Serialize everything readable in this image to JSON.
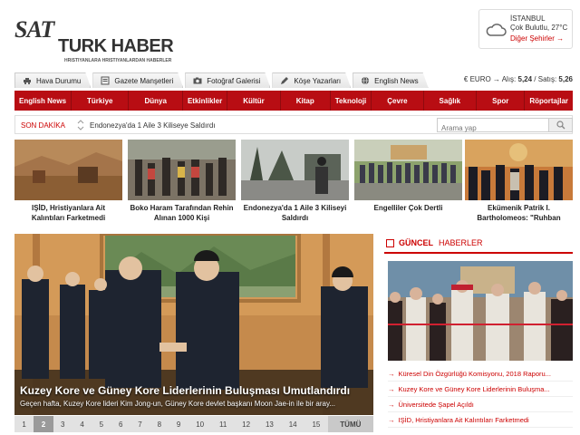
{
  "logo": {
    "badge": "SAT",
    "name": "TURK HABER",
    "tagline": "HRISTIYANLARA HRISTIYANLARDAN HABERLER"
  },
  "weather": {
    "city": "İSTANBUL",
    "condition": "Çok Bulutlu, 27°C",
    "other_cities": "Diğer Şehirler →",
    "icon": "cloud-icon"
  },
  "topnav": {
    "items": [
      {
        "label": "Hava Durumu",
        "icon": "car-icon"
      },
      {
        "label": "Gazete Manşetleri",
        "icon": "newspaper-icon"
      },
      {
        "label": "Fotoğraf Galerisi",
        "icon": "camera-icon"
      },
      {
        "label": "Köşe Yazarları",
        "icon": "pen-icon"
      },
      {
        "label": "English News",
        "icon": "globe-icon"
      }
    ],
    "rates_prefix": "€ EURO → Alış: ",
    "buy": "5,24",
    "rates_mid": " / Satış: ",
    "sell": "5,26"
  },
  "rednav": [
    "English News",
    "Türkiye",
    "Dünya",
    "Etkinlikler",
    "Kültür",
    "Kitap",
    "Teknoloji",
    "Çevre",
    "Sağlık",
    "Spor",
    "Röportajlar"
  ],
  "breaking": {
    "label": "SON DAKİKA",
    "text": "Endonezya'da 1 Aile 3 Kiliseye Saldırdı",
    "search_placeholder": "Arama yap"
  },
  "thumbs": [
    {
      "caption": "IŞİD, Hristiyanlara Ait Kalıntıları Farketmedi"
    },
    {
      "caption": "Boko Haram Tarafından Rehin Alınan 1000 Kişi"
    },
    {
      "caption": "Endonezya'da 1 Aile 3 Kiliseyi Saldırdı"
    },
    {
      "caption": "Engelliler Çok Dertli"
    },
    {
      "caption": "Ekümenik Patrik I. Bartholomeos: \"Ruhban"
    }
  ],
  "feature": {
    "title": "Kuzey Kore ve Güney Kore Liderlerinin Buluşması Umutlandırdı",
    "desc": "Geçen hafta, Kuzey Kore lideri Kim Jong-un, Güney Kore devlet başkanı Moon Jae-in ile bir aray..."
  },
  "pager": {
    "pages": [
      "1",
      "2",
      "3",
      "4",
      "5",
      "6",
      "7",
      "8",
      "9",
      "10",
      "11",
      "12",
      "13",
      "14",
      "15"
    ],
    "active": "2",
    "all": "TÜMÜ"
  },
  "sidebar": {
    "head_bold": "GÜNCEL",
    "head_rest": "HABERLER",
    "items": [
      "Küresel Din Özgürlüğü Komisyonu, 2018 Raporu...",
      "Kuzey Kore ve Güney Kore Liderlerinin Buluşma...",
      "Üniversitede Şapel Açıldı",
      "IŞİD, Hristiyanlara Ait Kalıntıları Farketmedi"
    ]
  }
}
